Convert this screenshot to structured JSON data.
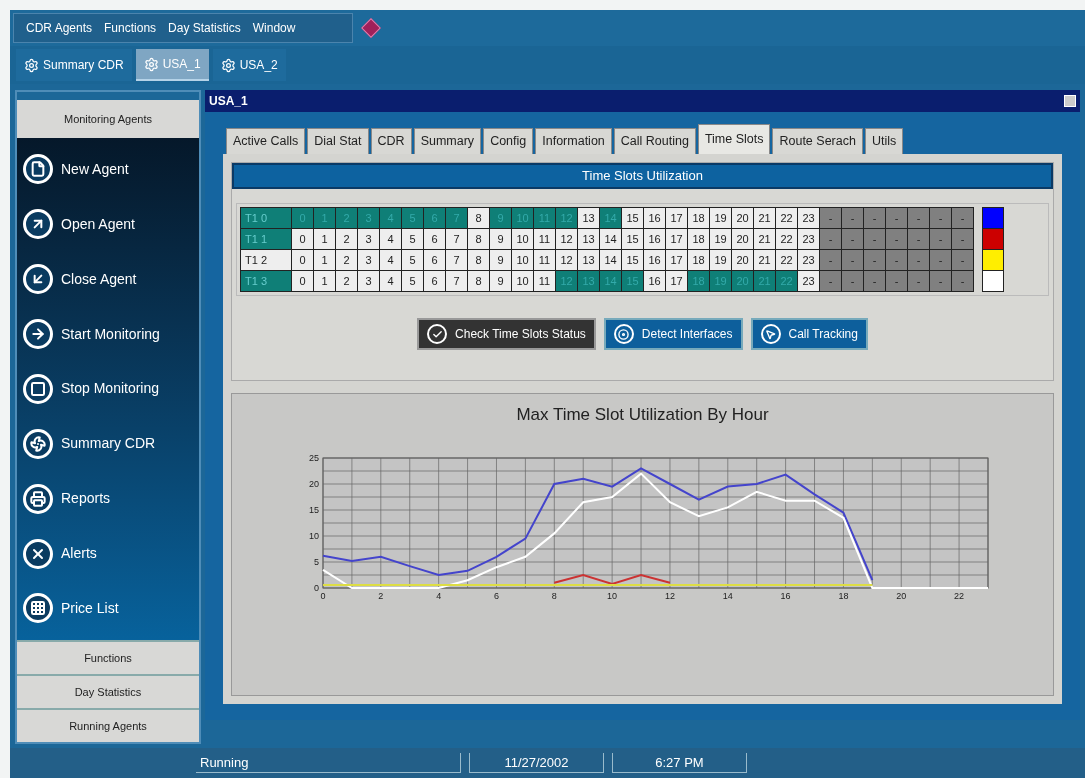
{
  "menu": [
    "CDR Agents",
    "Functions",
    "Day Statistics",
    "Window"
  ],
  "toolbar": [
    {
      "label": "Summary CDR",
      "selected": false
    },
    {
      "label": "USA_1",
      "selected": true
    },
    {
      "label": "USA_2",
      "selected": false
    }
  ],
  "sidebar": {
    "header": "Monitoring Agents",
    "items": [
      {
        "label": "New Agent"
      },
      {
        "label": "Open Agent"
      },
      {
        "label": "Close Agent"
      },
      {
        "label": "Start Monitoring"
      },
      {
        "label": "Stop Monitoring"
      },
      {
        "label": "Summary CDR"
      },
      {
        "label": "Reports"
      },
      {
        "label": "Alerts"
      },
      {
        "label": "Price List"
      }
    ],
    "sections": [
      "Functions",
      "Day Statistics",
      "Running Agents"
    ]
  },
  "window": {
    "title": "USA_1",
    "tabs": [
      {
        "label": "Active Calls",
        "selected": false
      },
      {
        "label": "Dial Stat",
        "selected": false
      },
      {
        "label": "CDR",
        "selected": false
      },
      {
        "label": "Summary",
        "selected": false
      },
      {
        "label": "Config",
        "selected": false
      },
      {
        "label": "Information",
        "selected": false
      },
      {
        "label": "Call Routing",
        "selected": false
      },
      {
        "label": "Time Slots",
        "selected": true
      },
      {
        "label": "Route Serach",
        "selected": false
      },
      {
        "label": "Utils",
        "selected": false
      }
    ],
    "section_title": "Time Slots Utilization",
    "grid": [
      {
        "label": "T1 0",
        "active": true,
        "color": "#0000ff",
        "cells": [
          {
            "text": "0",
            "active": true
          },
          {
            "text": "1",
            "active": true
          },
          {
            "text": "2",
            "active": true
          },
          {
            "text": "3",
            "active": true
          },
          {
            "text": "4",
            "active": true
          },
          {
            "text": "5",
            "active": true
          },
          {
            "text": "6",
            "active": true
          },
          {
            "text": "7",
            "active": true
          },
          {
            "text": "8",
            "active": false
          },
          {
            "text": "9",
            "active": true
          },
          {
            "text": "10",
            "active": true
          },
          {
            "text": "11",
            "active": true
          },
          {
            "text": "12",
            "active": true
          },
          {
            "text": "13",
            "active": false
          },
          {
            "text": "14",
            "active": true
          },
          {
            "text": "15",
            "active": false
          },
          {
            "text": "16",
            "active": false
          },
          {
            "text": "17",
            "active": false
          },
          {
            "text": "18",
            "active": false
          },
          {
            "text": "19",
            "active": false
          },
          {
            "text": "20",
            "active": false
          },
          {
            "text": "21",
            "active": false
          },
          {
            "text": "22",
            "active": false
          },
          {
            "text": "23",
            "active": false
          }
        ],
        "blanks": [
          "-",
          "-",
          "-",
          "-",
          "-",
          "-",
          "-"
        ]
      },
      {
        "label": "T1 1",
        "active": true,
        "color": "#cc0000",
        "cells": [
          {
            "text": "0",
            "active": false
          },
          {
            "text": "1",
            "active": false
          },
          {
            "text": "2",
            "active": false
          },
          {
            "text": "3",
            "active": false
          },
          {
            "text": "4",
            "active": false
          },
          {
            "text": "5",
            "active": false
          },
          {
            "text": "6",
            "active": false
          },
          {
            "text": "7",
            "active": false
          },
          {
            "text": "8",
            "active": false
          },
          {
            "text": "9",
            "active": false
          },
          {
            "text": "10",
            "active": false
          },
          {
            "text": "11",
            "active": false
          },
          {
            "text": "12",
            "active": false
          },
          {
            "text": "13",
            "active": false
          },
          {
            "text": "14",
            "active": false
          },
          {
            "text": "15",
            "active": false
          },
          {
            "text": "16",
            "active": false
          },
          {
            "text": "17",
            "active": false
          },
          {
            "text": "18",
            "active": false
          },
          {
            "text": "19",
            "active": false
          },
          {
            "text": "20",
            "active": false
          },
          {
            "text": "21",
            "active": false
          },
          {
            "text": "22",
            "active": false
          },
          {
            "text": "23",
            "active": false
          }
        ],
        "blanks": [
          "-",
          "-",
          "-",
          "-",
          "-",
          "-",
          "-"
        ]
      },
      {
        "label": "T1 2",
        "active": false,
        "color": "#ffee00",
        "cells": [
          {
            "text": "0",
            "active": false
          },
          {
            "text": "1",
            "active": false
          },
          {
            "text": "2",
            "active": false
          },
          {
            "text": "3",
            "active": false
          },
          {
            "text": "4",
            "active": false
          },
          {
            "text": "5",
            "active": false
          },
          {
            "text": "6",
            "active": false
          },
          {
            "text": "7",
            "active": false
          },
          {
            "text": "8",
            "active": false
          },
          {
            "text": "9",
            "active": false
          },
          {
            "text": "10",
            "active": false
          },
          {
            "text": "11",
            "active": false
          },
          {
            "text": "12",
            "active": false
          },
          {
            "text": "13",
            "active": false
          },
          {
            "text": "14",
            "active": false
          },
          {
            "text": "15",
            "active": false
          },
          {
            "text": "16",
            "active": false
          },
          {
            "text": "17",
            "active": false
          },
          {
            "text": "18",
            "active": false
          },
          {
            "text": "19",
            "active": false
          },
          {
            "text": "20",
            "active": false
          },
          {
            "text": "21",
            "active": false
          },
          {
            "text": "22",
            "active": false
          },
          {
            "text": "23",
            "active": false
          }
        ],
        "blanks": [
          "-",
          "-",
          "-",
          "-",
          "-",
          "-",
          "-"
        ]
      },
      {
        "label": "T1 3",
        "active": true,
        "color": "#ffffff",
        "cells": [
          {
            "text": "0",
            "active": false
          },
          {
            "text": "1",
            "active": false
          },
          {
            "text": "2",
            "active": false
          },
          {
            "text": "3",
            "active": false
          },
          {
            "text": "4",
            "active": false
          },
          {
            "text": "5",
            "active": false
          },
          {
            "text": "6",
            "active": false
          },
          {
            "text": "7",
            "active": false
          },
          {
            "text": "8",
            "active": false
          },
          {
            "text": "9",
            "active": false
          },
          {
            "text": "10",
            "active": false
          },
          {
            "text": "11",
            "active": false
          },
          {
            "text": "12",
            "active": true
          },
          {
            "text": "13",
            "active": true
          },
          {
            "text": "14",
            "active": true
          },
          {
            "text": "15",
            "active": true
          },
          {
            "text": "16",
            "active": false
          },
          {
            "text": "17",
            "active": false
          },
          {
            "text": "18",
            "active": true
          },
          {
            "text": "19",
            "active": true
          },
          {
            "text": "20",
            "active": true
          },
          {
            "text": "21",
            "active": true
          },
          {
            "text": "22",
            "active": true
          },
          {
            "text": "23",
            "active": false
          }
        ],
        "blanks": [
          "-",
          "-",
          "-",
          "-",
          "-",
          "-",
          "-"
        ]
      }
    ],
    "buttons": [
      {
        "label": "Check Time Slots Status",
        "kind": "dark"
      },
      {
        "label": "Detect Interfaces",
        "kind": "blue"
      },
      {
        "label": "Call Tracking",
        "kind": "blue"
      }
    ],
    "chart_data": {
      "type": "line",
      "title": "Max Time Slot Utilization By Hour",
      "grid": true,
      "x": [
        0,
        1,
        2,
        3,
        4,
        5,
        6,
        7,
        8,
        9,
        10,
        11,
        12,
        13,
        14,
        15,
        16,
        17,
        18,
        19,
        20,
        21,
        22,
        23
      ],
      "xlim": [
        0,
        23
      ],
      "ylim": [
        0,
        25
      ],
      "xticks": [
        0,
        2,
        4,
        6,
        8,
        10,
        12,
        14,
        16,
        18,
        20,
        22
      ],
      "yticks": [
        0,
        5,
        10,
        15,
        20,
        25
      ],
      "series": [
        {
          "color": "#4444cc",
          "values": [
            6.2,
            5.2,
            6,
            4.2,
            2.5,
            3.3,
            6,
            9.5,
            20,
            21,
            19.5,
            23,
            20,
            17,
            19.5,
            20,
            21.8,
            18,
            14.5,
            1.5,
            null,
            null,
            null,
            null
          ]
        },
        {
          "color": "#ffffff",
          "values": [
            3.5,
            0,
            0,
            0,
            0,
            1.5,
            4,
            6,
            10.5,
            16.5,
            17.5,
            22,
            16.5,
            13.8,
            15.5,
            18.5,
            16.8,
            16.8,
            13.5,
            0,
            0,
            0,
            0,
            0
          ]
        },
        {
          "color": "#cc3333",
          "values": [
            null,
            null,
            null,
            null,
            null,
            null,
            null,
            null,
            1,
            2.5,
            0.8,
            2.5,
            1,
            null,
            null,
            null,
            null,
            null,
            null,
            null,
            null,
            null,
            null,
            null
          ]
        },
        {
          "color": "#dddd44",
          "values": [
            0.6,
            0.6,
            0.6,
            0.6,
            0.6,
            0.6,
            0.6,
            0.6,
            0.6,
            0.6,
            0.6,
            0.6,
            0.6,
            0.6,
            0.6,
            0.6,
            0.6,
            0.6,
            0.6,
            0.6,
            null,
            null,
            null,
            null
          ]
        }
      ]
    }
  },
  "status_bar": [
    "Running",
    "11/27/2002",
    "6:27 PM"
  ]
}
